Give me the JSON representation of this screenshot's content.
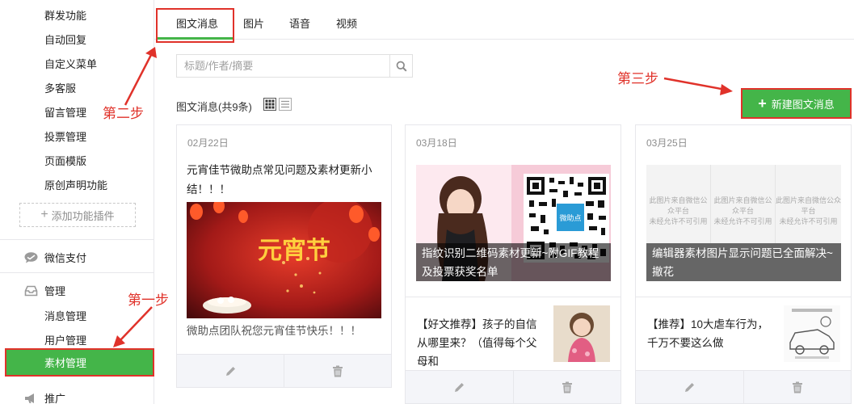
{
  "sidebar": {
    "feature_items": [
      "群发功能",
      "自动回复",
      "自定义菜单",
      "多客服",
      "留言管理",
      "投票管理",
      "页面模版",
      "原创声明功能"
    ],
    "add_plugin_label": "添加功能插件",
    "groups": {
      "payment": "微信支付",
      "manage": "管理",
      "promote": "推广"
    },
    "manage_items": [
      "消息管理",
      "用户管理"
    ],
    "active_item": "素材管理"
  },
  "tabs": [
    "图文消息",
    "图片",
    "语音",
    "视频"
  ],
  "active_tab": 0,
  "search": {
    "placeholder": "标题/作者/摘要"
  },
  "list": {
    "title": "图文消息(共9条)"
  },
  "new_button_label": "新建图文消息",
  "annotations": {
    "step1": "第一步",
    "step2": "第二步",
    "step3": "第三步"
  },
  "cards": [
    {
      "date": "02月22日",
      "title": "元宵佳节微助点常见问题及素材更新小结！！！",
      "cover_art_text": "元宵节",
      "summary": "微助点团队祝您元宵佳节快乐！！！"
    },
    {
      "date": "03月18日",
      "cover_caption": "指纹识别二维码素材更新~附GIF教程及投票获奖名单",
      "cover_logo_text": "微助点",
      "sub_title": "【好文推荐】孩子的自信从哪里来？（值得每个父母和"
    },
    {
      "date": "03月25日",
      "cover_caption": "编辑器素材图片显示问题已全面解决~撤花",
      "watermark_line1": "此图片来自微信公众平台",
      "watermark_line2": "未经允许不可引用",
      "sub_title": "【推荐】10大虐车行为，千万不要这么做"
    }
  ],
  "colors": {
    "accent_green": "#44b549",
    "annotation_red": "#e0322a",
    "border": "#e7e7eb"
  }
}
